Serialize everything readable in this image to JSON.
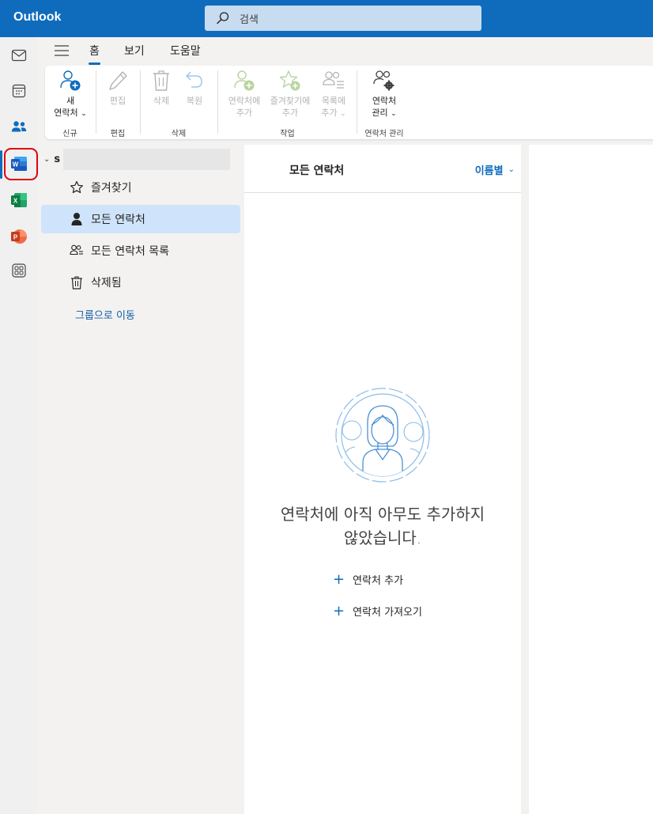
{
  "app": {
    "title": "Outlook"
  },
  "search": {
    "placeholder": "검색"
  },
  "tabs": [
    {
      "label": "홈",
      "active": true
    },
    {
      "label": "보기"
    },
    {
      "label": "도움말"
    }
  ],
  "ribbon": {
    "new_group": {
      "name": "신규",
      "new_contact_line1": "새",
      "new_contact_line2": "연락처"
    },
    "edit_group": {
      "name": "편집",
      "edit": "편집"
    },
    "delete_group": {
      "name": "삭제",
      "delete": "삭제",
      "restore": "복원"
    },
    "actions_group": {
      "name": "작업",
      "add_to_contacts_line1": "연락처에",
      "add_to_contacts_line2": "추가",
      "add_to_favorites_line1": "즐겨찾기에",
      "add_to_favorites_line2": "추가",
      "add_to_list_line1": "목록에",
      "add_to_list_line2": "추가"
    },
    "manage_group": {
      "name": "연락처 관리",
      "manage_line1": "연락처",
      "manage_line2": "관리"
    }
  },
  "folders": {
    "account_initial": "s",
    "items": [
      {
        "label": "즐겨찾기",
        "icon": "star-icon"
      },
      {
        "label": "모든 연락처",
        "icon": "person-icon",
        "selected": true
      },
      {
        "label": "모든 연락처 목록",
        "icon": "people-list-icon"
      },
      {
        "label": "삭제됨",
        "icon": "trash-icon"
      }
    ],
    "goto_groups": "그룹으로 이동"
  },
  "list": {
    "title": "모든 연락처",
    "sort_label": "이름별",
    "empty_line1": "연락처에 아직 아무도 추가하지",
    "empty_line2": "않았습니다.",
    "add_contact": "연락처 추가",
    "import_contacts": "연락처 가져오기"
  },
  "colors": {
    "brand": "#0f6cbd",
    "selected": "#cfe4fa",
    "highlight": "#e3000f"
  }
}
